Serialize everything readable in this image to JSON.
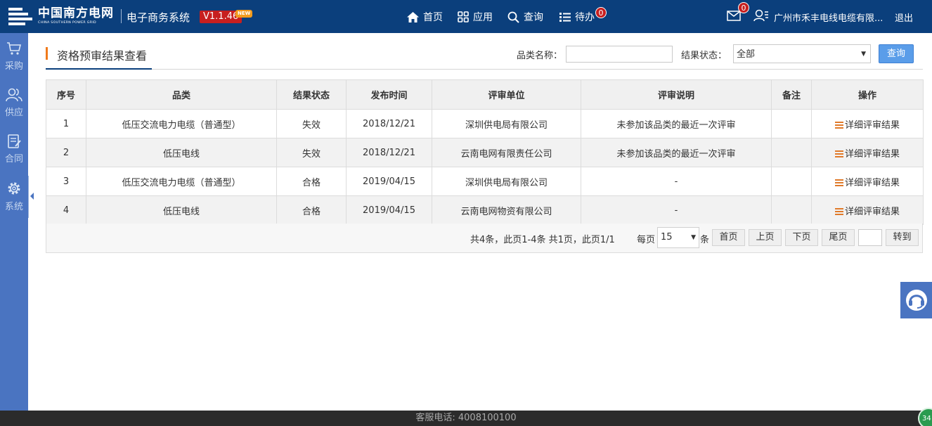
{
  "header": {
    "logo_cn": "中国南方电网",
    "logo_en": "CHINA SOUTHERN POWER GRID",
    "system_name": "电子商务系统",
    "version": "V1.1.46",
    "new_tag": "NEW",
    "nav": [
      {
        "label": "首页",
        "icon": "home-icon"
      },
      {
        "label": "应用",
        "icon": "apps-icon"
      },
      {
        "label": "查询",
        "icon": "search-icon"
      },
      {
        "label": "待办",
        "icon": "list-icon",
        "badge": "0"
      }
    ],
    "mail_badge": "0",
    "user_name": "广州市禾丰电线电缆有限...",
    "logout": "退出"
  },
  "sidebar": {
    "items": [
      {
        "label": "采购",
        "icon": "cart-icon"
      },
      {
        "label": "供应",
        "icon": "users-icon"
      },
      {
        "label": "合同",
        "icon": "contract-icon"
      },
      {
        "label": "系统",
        "icon": "gear-icon"
      }
    ]
  },
  "page": {
    "title": "资格预审结果查看",
    "filter": {
      "category_label": "品类名称：",
      "category_value": "",
      "status_label": "结果状态：",
      "status_value": "全部",
      "query_button": "查询"
    }
  },
  "table": {
    "columns": [
      "序号",
      "品类",
      "结果状态",
      "发布时间",
      "评审单位",
      "评审说明",
      "备注",
      "操作"
    ],
    "rows": [
      {
        "no": "1",
        "category": "低压交流电力电缆（普通型）",
        "status": "失效",
        "date": "2018/12/21",
        "unit": "深圳供电局有限公司",
        "note": "未参加该品类的最近一次评审",
        "remark": "",
        "action": "详细评审结果"
      },
      {
        "no": "2",
        "category": "低压电线",
        "status": "失效",
        "date": "2018/12/21",
        "unit": "云南电网有限责任公司",
        "note": "未参加该品类的最近一次评审",
        "remark": "",
        "action": "详细评审结果"
      },
      {
        "no": "3",
        "category": "低压交流电力电缆（普通型）",
        "status": "合格",
        "date": "2019/04/15",
        "unit": "深圳供电局有限公司",
        "note": "-",
        "remark": "",
        "action": "详细评审结果"
      },
      {
        "no": "4",
        "category": "低压电线",
        "status": "合格",
        "date": "2019/04/15",
        "unit": "云南电网物资有限公司",
        "note": "-",
        "remark": "",
        "action": "详细评审结果"
      }
    ]
  },
  "pager": {
    "summary": "共4条，此页1-4条 共1页，此页1/1",
    "per_page_label": "每页",
    "per_page_value": "15",
    "unit": "条",
    "first": "首页",
    "prev": "上页",
    "next": "下页",
    "last": "尾页",
    "goto_value": "",
    "goto": "转到"
  },
  "footer": {
    "service_phone": "客服电话: 4008100100",
    "corner_badge": "34"
  },
  "colors": {
    "header_bg": "#0b3f7c",
    "sidebar_bg": "#4a74c1",
    "accent_orange": "#f07a1b",
    "query_button": "#5a9de9",
    "badge_red": "#c71f1f"
  }
}
